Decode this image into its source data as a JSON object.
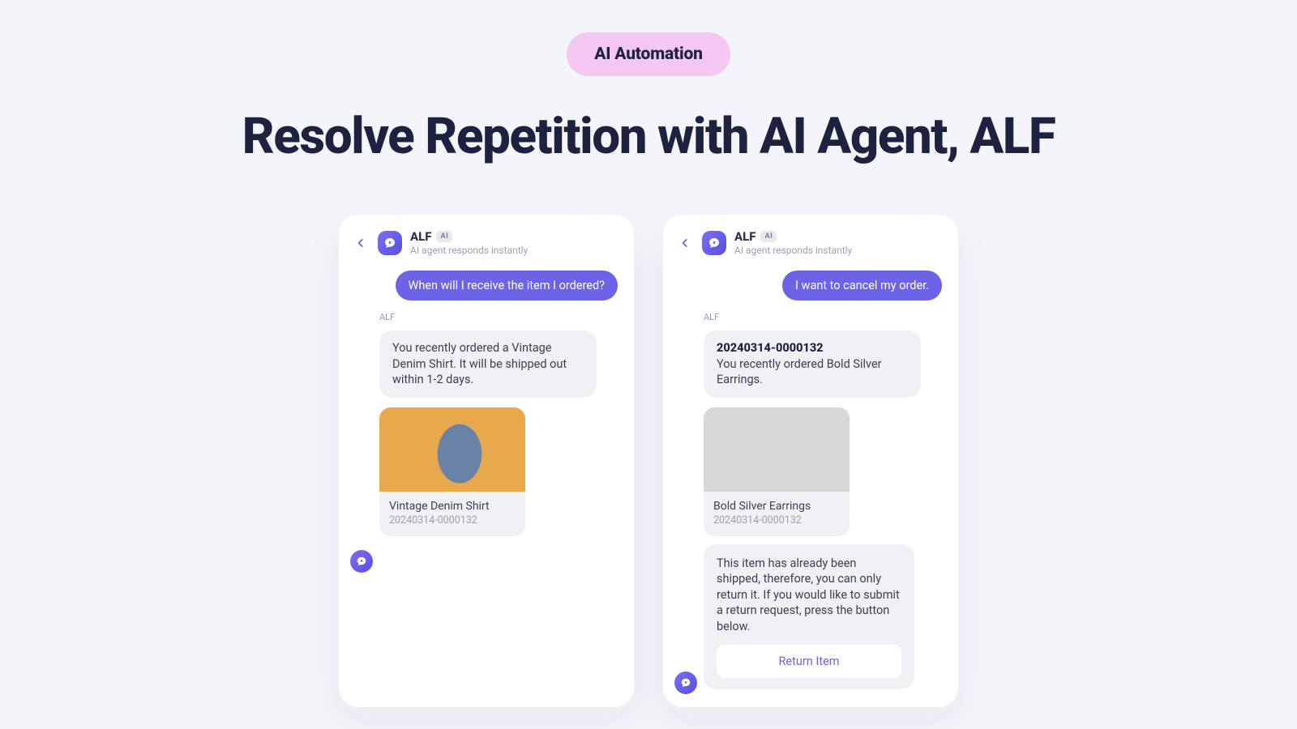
{
  "pill_label": "AI Automation",
  "headline": "Resolve Repetition with AI Agent, ALF",
  "ai_badge": "AI",
  "chat_left": {
    "agent_name": "ALF",
    "agent_subtitle": "AI agent responds instantly",
    "user_msg": "When will I receive the item I ordered?",
    "sender_label": "ALF",
    "bot_reply": "You recently ordered a Vintage Denim Shirt. It will be shipped out within 1-2 days.",
    "product_name": "Vintage Denim Shirt",
    "order_number": "20240314-0000132"
  },
  "chat_right": {
    "agent_name": "ALF",
    "agent_subtitle": "AI agent responds instantly",
    "user_msg": "I want to cancel my order.",
    "sender_label": "ALF",
    "order_number_bold": "20240314-0000132",
    "bot_reply_1": "You recently ordered Bold Silver Earrings.",
    "product_name": "Bold Silver Earrings",
    "order_number": "20240314-0000132",
    "bot_reply_2": "This item has already been shipped, therefore, you can only return it. If you would like to submit a return request, press the button below.",
    "return_button": "Return Item"
  }
}
